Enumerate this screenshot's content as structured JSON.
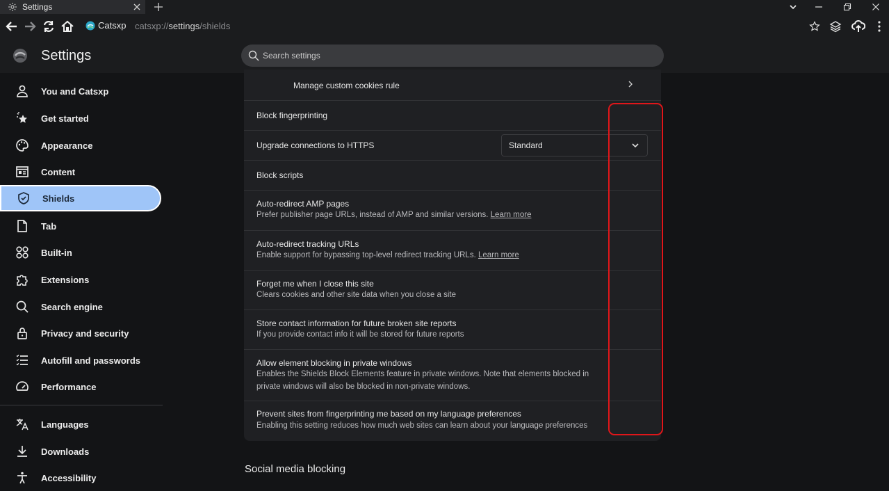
{
  "browser": {
    "tab_title": "Settings",
    "site_name": "Catsxp",
    "url_scheme": "catsxp://",
    "url_host": "settings",
    "url_path": "/shields"
  },
  "header": {
    "title": "Settings",
    "search_placeholder": "Search settings"
  },
  "sidebar": {
    "items": [
      {
        "label": "You and Catsxp",
        "icon": "person-icon"
      },
      {
        "label": "Get started",
        "icon": "sparkle-star-icon"
      },
      {
        "label": "Appearance",
        "icon": "palette-icon"
      },
      {
        "label": "Content",
        "icon": "content-layout-icon"
      },
      {
        "label": "Shields",
        "icon": "shield-icon",
        "active": true
      },
      {
        "label": "Tab",
        "icon": "page-icon"
      },
      {
        "label": "Built-in",
        "icon": "grid-icon"
      },
      {
        "label": "Extensions",
        "icon": "puzzle-icon"
      },
      {
        "label": "Search engine",
        "icon": "search-icon"
      },
      {
        "label": "Privacy and security",
        "icon": "lock-icon"
      },
      {
        "label": "Autofill and passwords",
        "icon": "list-icon"
      },
      {
        "label": "Performance",
        "icon": "gauge-icon"
      },
      {
        "label": "Languages",
        "icon": "translate-icon"
      },
      {
        "label": "Downloads",
        "icon": "download-icon"
      },
      {
        "label": "Accessibility",
        "icon": "accessibility-icon"
      }
    ]
  },
  "main": {
    "rows": [
      {
        "title": "Manage custom cookies rule"
      },
      {
        "title": "Block fingerprinting"
      },
      {
        "title": "Upgrade connections to HTTPS",
        "select_value": "Standard"
      },
      {
        "title": "Block scripts"
      },
      {
        "title": "Auto-redirect AMP pages",
        "subtitle": "Prefer publisher page URLs, instead of AMP and similar versions.",
        "link": "Learn more"
      },
      {
        "title": "Auto-redirect tracking URLs",
        "subtitle": "Enable support for bypassing top-level redirect tracking URLs.",
        "link": "Learn more"
      },
      {
        "title": "Forget me when I close this site",
        "subtitle": "Clears cookies and other site data when you close a site"
      },
      {
        "title": "Store contact information for future broken site reports",
        "subtitle": "If you provide contact info it will be stored for future reports"
      },
      {
        "title": "Allow element blocking in private windows",
        "subtitle": "Enables the Shields Block Elements feature in private windows. Note that elements blocked in private windows will also be blocked in non-private windows."
      },
      {
        "title": "Prevent sites from fingerprinting me based on my language preferences",
        "subtitle": "Enabling this setting reduces how much web sites can learn about your language preferences"
      }
    ],
    "next_section_title": "Social media blocking"
  },
  "colors": {
    "accent": "#9fc5f8",
    "highlight": "#e0161a"
  }
}
